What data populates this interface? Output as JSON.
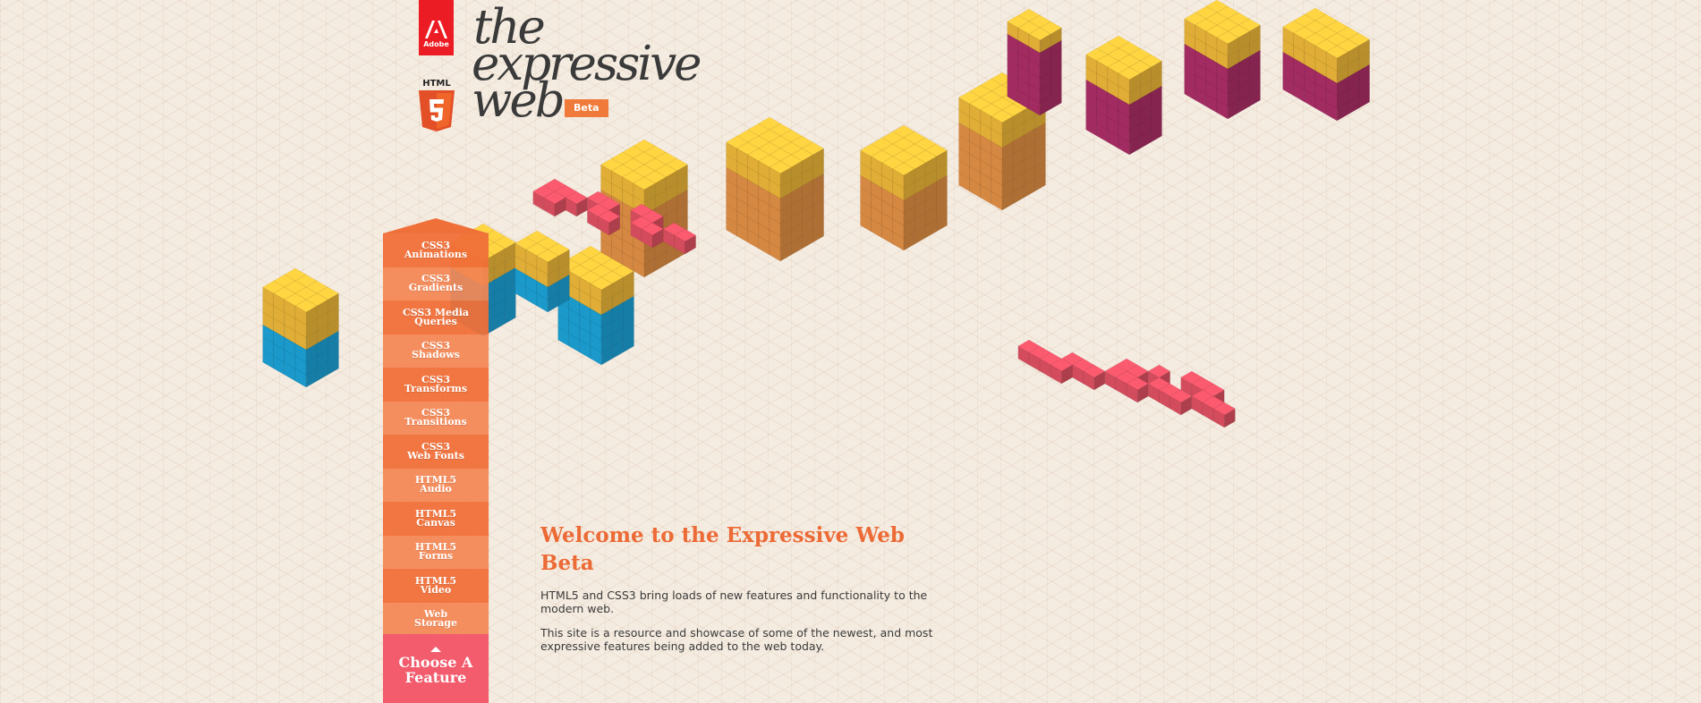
{
  "brand": {
    "adobe_label": "Adobe",
    "html5_label": "HTML",
    "title_lines": [
      "the",
      "expressive",
      "web"
    ],
    "beta_badge": "Beta"
  },
  "feature_menu": {
    "items": [
      {
        "label": "CSS3\nAnimations"
      },
      {
        "label": "CSS3\nGradients"
      },
      {
        "label": "CSS3 Media\nQueries"
      },
      {
        "label": "CSS3\nShadows"
      },
      {
        "label": "CSS3\nTransforms"
      },
      {
        "label": "CSS3\nTransitions"
      },
      {
        "label": "CSS3\nWeb Fonts"
      },
      {
        "label": "HTML5\nAudio"
      },
      {
        "label": "HTML5\nCanvas"
      },
      {
        "label": "HTML5\nForms"
      },
      {
        "label": "HTML5\nVideo"
      },
      {
        "label": "Web\nStorage"
      }
    ],
    "choose_label": "Choose A\nFeature"
  },
  "welcome": {
    "heading": "Welcome to the Expressive Web Beta",
    "paragraphs": [
      "HTML5 and CSS3 bring loads of new features and functionality to the modern web.",
      "This site is a resource and showcase of some of the newest, and most expressive features being added to the web today."
    ]
  },
  "colors": {
    "background": "#f5ece1",
    "menu_orange": "#f0703a",
    "menu_orange_light": "#f48552",
    "choose_pink": "#f25c6d",
    "heading_orange": "#ec6a35",
    "block_yellow": "#ffc53d",
    "block_orange": "#f29a4a",
    "block_blue": "#1eaee6",
    "block_magenta": "#b8326e",
    "block_pink": "#f0566a",
    "adobe_red": "#ec1c24",
    "html5_orange": "#e34f26"
  }
}
